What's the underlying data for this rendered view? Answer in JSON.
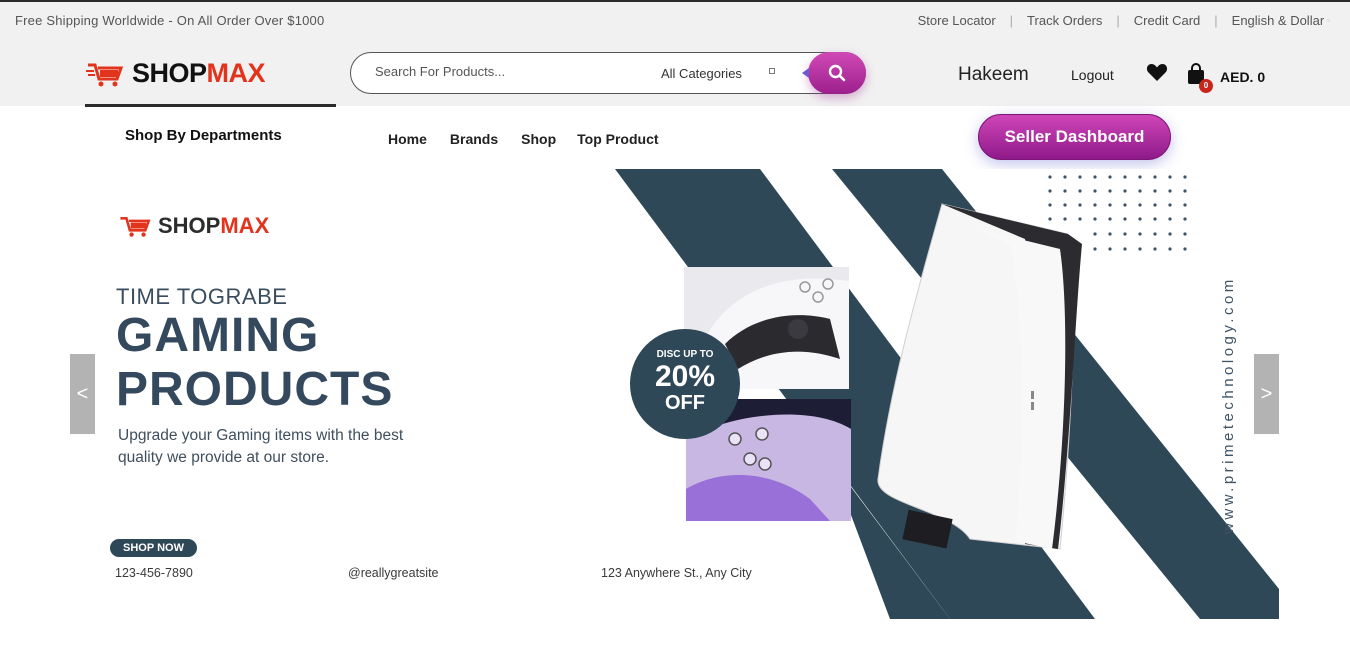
{
  "topbar": {
    "promo": "Free Shipping Worldwide - On All Order Over $1000",
    "links": [
      "Store Locator",
      "Track Orders",
      "Credit Card",
      "English & Dollar"
    ]
  },
  "brand": {
    "part1": "SHOP",
    "part2": "MAX"
  },
  "search": {
    "placeholder": "Search For Products...",
    "category": "All Categories"
  },
  "user": {
    "name": "Hakeem",
    "logout": "Logout",
    "cart_count": "0",
    "cart_total": "AED. 0"
  },
  "nav": {
    "departments": "Shop By Departments",
    "items": [
      "Home",
      "Brands",
      "Shop",
      "Top Product"
    ],
    "seller_button": "Seller Dashboard"
  },
  "banner": {
    "brand_part1": "SHOP",
    "brand_part2": "MAX",
    "subtitle": "TIME TOGRABE",
    "headline1": "GAMING",
    "headline2": "PRODUCTS",
    "desc1": "Upgrade your Gaming items with the best",
    "desc2": "quality we provide at our store.",
    "shop_now": "SHOP NOW",
    "phone": "123-456-7890",
    "social": "@reallygreatsite",
    "address": "123 Anywhere St., Any City",
    "discount_line1": "DISC UP TO",
    "discount_line2": "20%",
    "discount_line3": "OFF",
    "website": "www.primetechnology.com",
    "prev": "<",
    "next": ">"
  },
  "colors": {
    "accent": "#b0309f",
    "brand_red": "#e2341d",
    "banner_navy": "#2f4858"
  }
}
